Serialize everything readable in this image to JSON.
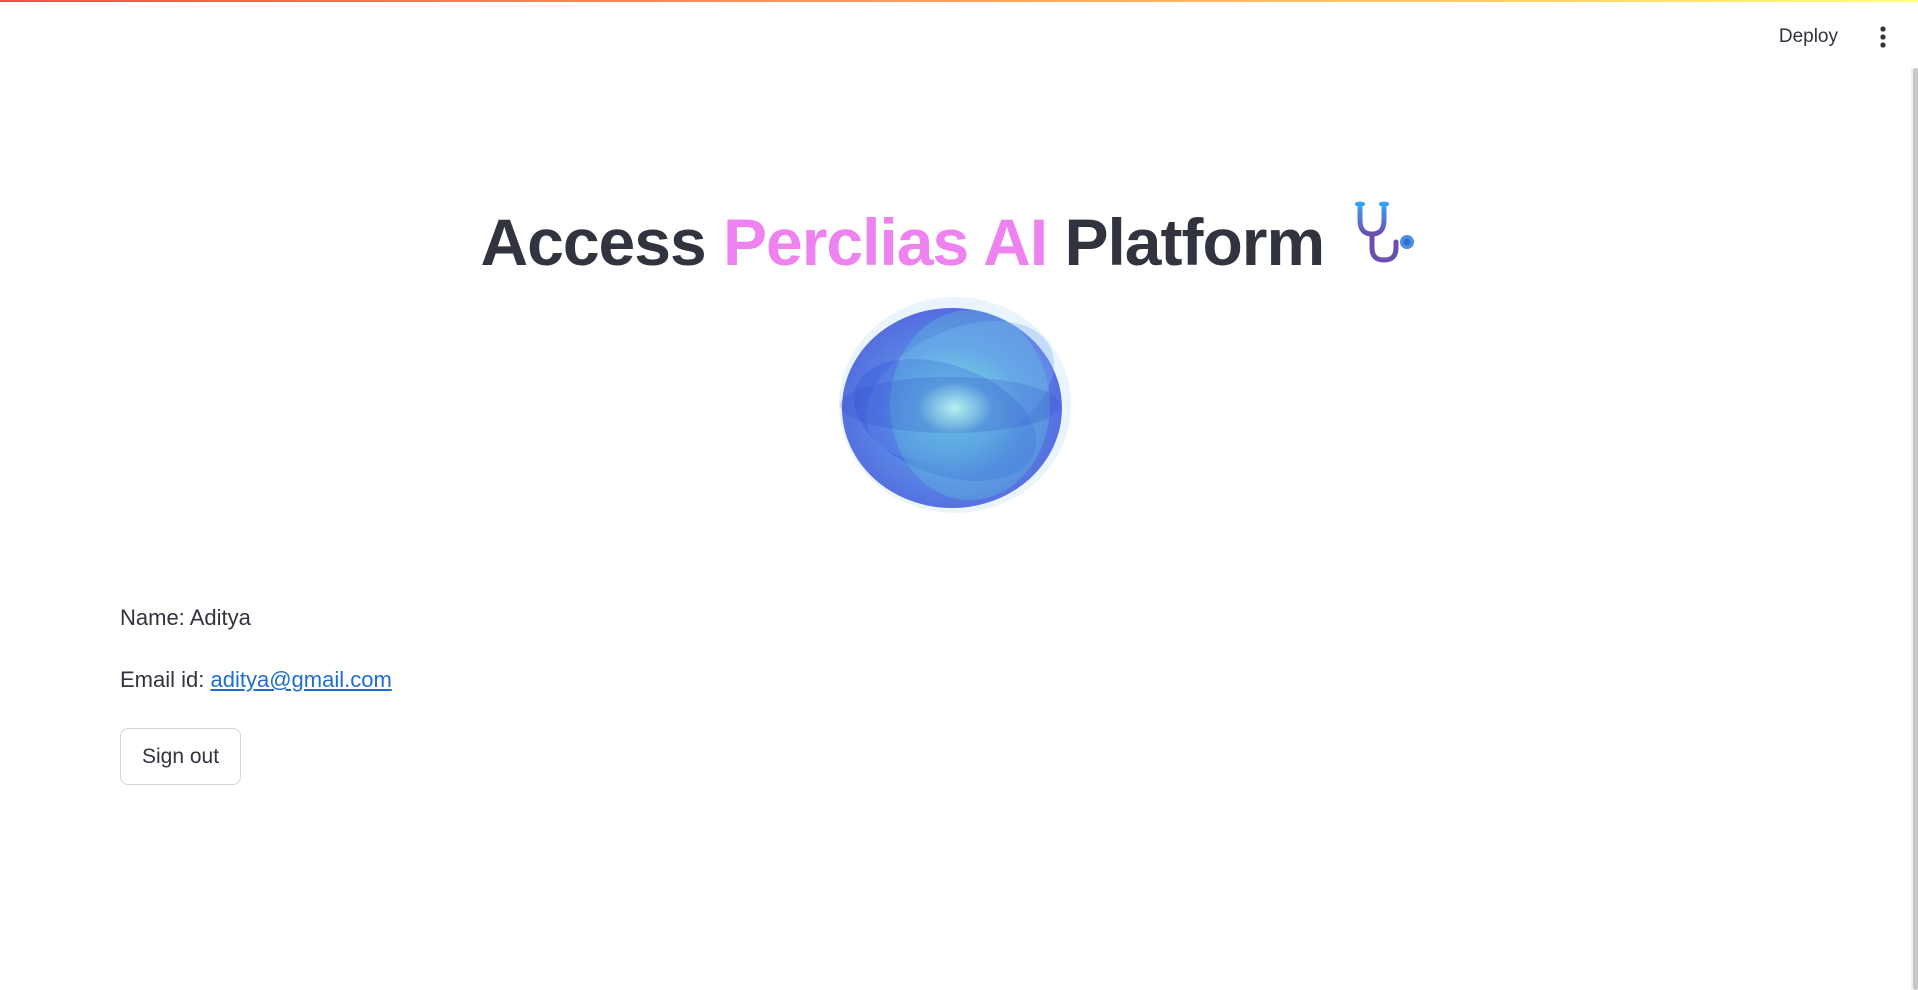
{
  "header": {
    "deploy_label": "Deploy",
    "menu_icon": "kebab-menu-icon"
  },
  "title": {
    "part1": "Access ",
    "accent": "Perclias AI",
    "part2": " Platform",
    "icon": "stethoscope-icon",
    "accent_color": "#ee82ee"
  },
  "logo": {
    "icon": "blue-orb-logo"
  },
  "profile": {
    "name_label": "Name: ",
    "name_value": "Aditya",
    "email_label": "Email id: ",
    "email_value": "aditya@gmail.com"
  },
  "actions": {
    "signout_label": "Sign out"
  },
  "colors": {
    "text": "#31333f",
    "link": "#1f6dd1",
    "accent": "#ee82ee"
  }
}
